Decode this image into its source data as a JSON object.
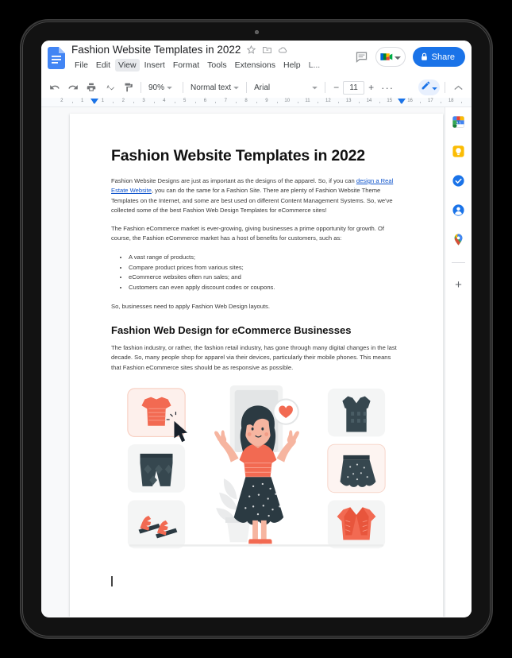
{
  "app": {
    "name": "Google Docs",
    "logo_icon": "docs-file-icon"
  },
  "header": {
    "title": "Fashion Website Templates in 2022",
    "title_icons": [
      "star-icon",
      "move-to-folder-icon",
      "cloud-saved-icon"
    ],
    "menu": [
      {
        "label": "File",
        "active": false
      },
      {
        "label": "Edit",
        "active": false
      },
      {
        "label": "View",
        "active": true
      },
      {
        "label": "Insert",
        "active": false
      },
      {
        "label": "Format",
        "active": false
      },
      {
        "label": "Tools",
        "active": false
      },
      {
        "label": "Extensions",
        "active": false
      },
      {
        "label": "Help",
        "active": false
      },
      {
        "label": "L...",
        "active": false
      }
    ],
    "comment_icon": "comment-icon",
    "meet_icon": "google-meet-icon",
    "meet_caret": "chevron-down-icon",
    "share_label": "Share",
    "share_lock_icon": "lock-icon",
    "share_color": "#1a73e8"
  },
  "toolbar": {
    "icons": [
      "undo-icon",
      "redo-icon",
      "print-icon",
      "spellcheck-icon",
      "paint-format-icon"
    ],
    "zoom_value": "90%",
    "style_value": "Normal text",
    "font_value": "Arial",
    "font_size_value": "11",
    "font_size_decrease": "−",
    "font_size_increase": "+",
    "more_label": "···",
    "mode_icon": "pen-edit-icon",
    "mode_caret": "chevron-down-icon",
    "collapse_icon": "chevron-up-icon"
  },
  "ruler": {
    "labels": [
      "2",
      "1",
      "1",
      "2",
      "3",
      "4",
      "5",
      "6",
      "7",
      "8",
      "9",
      "10",
      "11",
      "12",
      "13",
      "14",
      "15",
      "16",
      "17",
      "18"
    ],
    "left_indent_marker": "indent-marker",
    "right_margin_marker": "indent-marker"
  },
  "document": {
    "h1": "Fashion Website Templates in 2022",
    "p1_before_link": "Fashion Website Designs are just as important as the designs of the apparel. So, if you can ",
    "p1_link": "design a Real Estate Website",
    "p1_after_link": ", you can do the same for a Fashion Site. There are plenty of Fashion Website Theme Templates on the Internet, and some are best used on different Content Management Systems. So, we've collected some of the best Fashion Web Design Templates for eCommerce sites!",
    "p2": "The Fashion eCommerce market is ever-growing, giving businesses a prime opportunity for growth. Of course, the Fashion eCommerce market has a host of benefits for customers, such as:",
    "bullets": [
      "A vast range of products;",
      "Compare product prices from various sites;",
      "eCommerce websites often run sales; and",
      "Customers can even apply discount codes or coupons."
    ],
    "p3": "So, businesses need to apply Fashion Web Design layouts.",
    "h2": "Fashion Web Design for eCommerce Businesses",
    "p4": "The fashion industry, or rather, the fashion retail industry, has gone through many digital changes in the last decade. So, many people shop for apparel via their devices, particularly their mobile phones. This means that Fashion eCommerce sites should be as responsive as possible.",
    "illustration_alt": "woman shopping online with clothing item cards"
  },
  "app_sidebar": {
    "items": [
      {
        "name": "google-calendar-icon"
      },
      {
        "name": "google-keep-icon"
      },
      {
        "name": "google-tasks-icon"
      },
      {
        "name": "google-contacts-icon"
      },
      {
        "name": "google-maps-icon"
      }
    ],
    "add_label": "+"
  },
  "colors": {
    "accent": "#1a73e8",
    "link": "#1155cc",
    "illustration_coral": "#f26a52",
    "illustration_dark": "#2b3a42"
  }
}
